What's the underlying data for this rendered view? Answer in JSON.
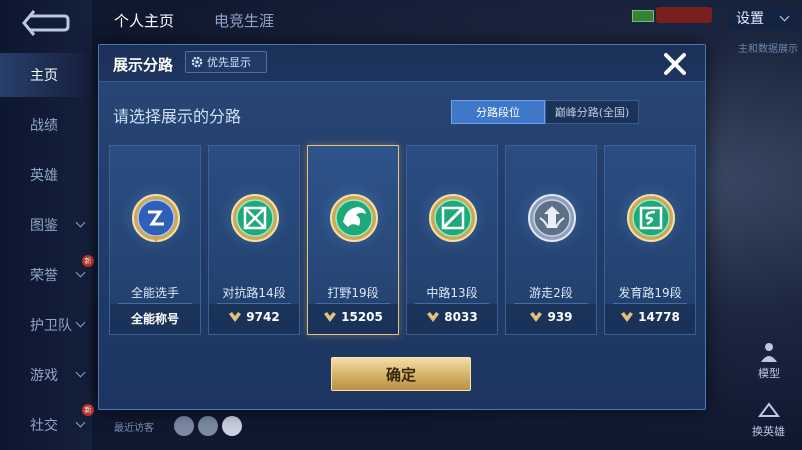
{
  "background": {
    "tabs": [
      "个人主页",
      "电竞生涯"
    ],
    "settings_label": "设置",
    "status_badge": "",
    "hint_text": "主和数据展示",
    "sidebar": [
      "主页",
      "战绩",
      "英雄",
      "图鉴",
      "荣誉",
      "护卫队",
      "游戏",
      "社交"
    ],
    "new_badge": "新",
    "recent_visitors": "最近访客",
    "right_buttons": [
      "模型",
      "换英雄"
    ]
  },
  "modal": {
    "title": "展示分路",
    "priority_label": "优先显示",
    "subtitle": "请选择展示的分路",
    "toggle_active": "分路段位",
    "toggle_inactive": "巅峰分路(全国)",
    "confirm_label": "确定",
    "cards": [
      {
        "name": "全能选手",
        "value": "全能称号",
        "icon": "all-round-badge-icon",
        "selected": false
      },
      {
        "name": "对抗路14段",
        "value": "9742",
        "icon": "clash-lane-badge-icon",
        "selected": false
      },
      {
        "name": "打野19段",
        "value": "15205",
        "icon": "jungle-badge-icon",
        "selected": true
      },
      {
        "name": "中路13段",
        "value": "8033",
        "icon": "mid-lane-badge-icon",
        "selected": false
      },
      {
        "name": "游走2段",
        "value": "939",
        "icon": "roam-badge-icon",
        "selected": false
      },
      {
        "name": "发育路19段",
        "value": "14778",
        "icon": "farm-lane-badge-icon",
        "selected": false
      }
    ]
  },
  "colors": {
    "accent_gold": "#e7c079",
    "modal_bg": "#223e6c",
    "toggle_active": "#3f78c8"
  }
}
